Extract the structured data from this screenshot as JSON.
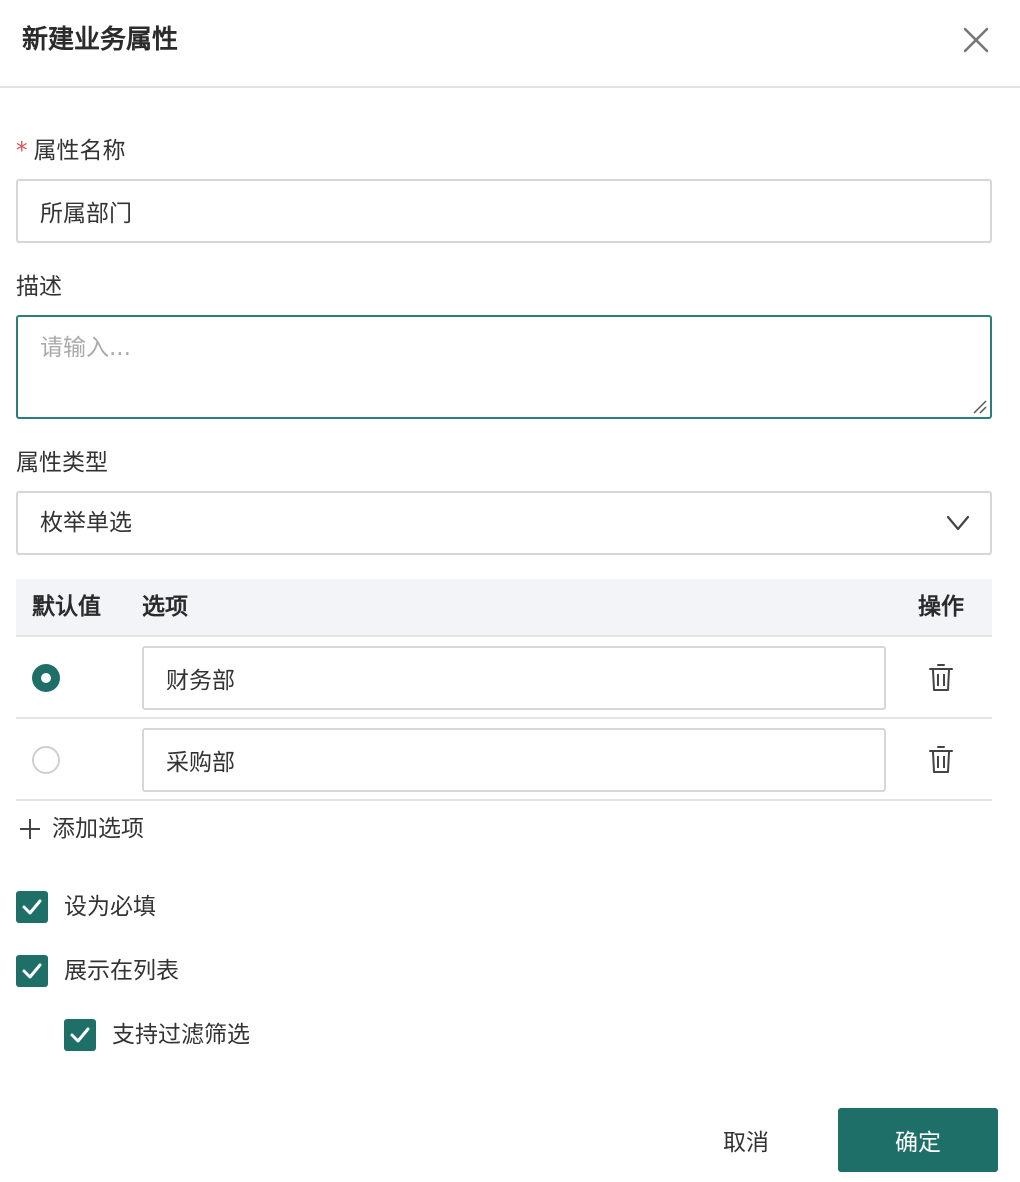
{
  "dialog": {
    "title": "新建业务属性",
    "close_icon": "close-icon"
  },
  "form": {
    "name": {
      "required_mark": "*",
      "label": "属性名称",
      "value": "所属部门"
    },
    "description": {
      "label": "描述",
      "value": "",
      "placeholder": "请输入..."
    },
    "type": {
      "label": "属性类型",
      "selected": "枚举单选",
      "icon": "chevron-down-icon"
    },
    "options_table": {
      "headers": {
        "default": "默认值",
        "option": "选项",
        "action": "操作"
      },
      "rows": [
        {
          "is_default": true,
          "value": "财务部",
          "action_icon": "trash-icon"
        },
        {
          "is_default": false,
          "value": "采购部",
          "action_icon": "trash-icon"
        }
      ],
      "add_label": "添加选项",
      "add_icon": "plus-icon"
    },
    "checkboxes": [
      {
        "label": "设为必填",
        "checked": true
      },
      {
        "label": "展示在列表",
        "checked": true
      },
      {
        "label": "支持过滤筛选",
        "checked": true
      }
    ]
  },
  "footer": {
    "cancel_label": "取消",
    "confirm_label": "确定"
  },
  "colors": {
    "accent": "#1f6f69",
    "focus_border": "#2a7f78",
    "required": "#d9534f",
    "header_bg": "#f3f4f8",
    "border": "#d6d6d6"
  }
}
